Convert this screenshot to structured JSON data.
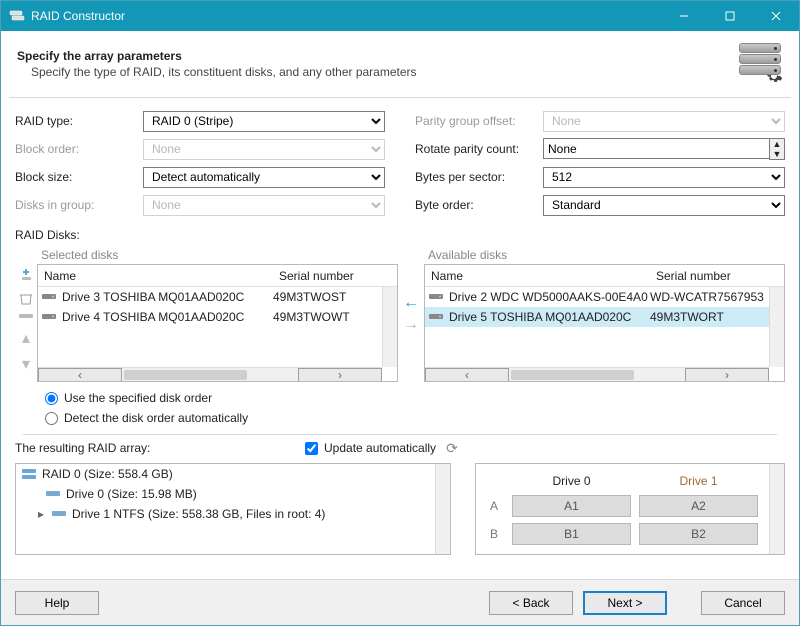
{
  "window": {
    "title": "RAID Constructor"
  },
  "header": {
    "title": "Specify the array parameters",
    "subtitle": "Specify the type of RAID, its constituent disks, and any other parameters"
  },
  "params_left": {
    "raid_type": {
      "label": "RAID type:",
      "value": "RAID 0 (Stripe)",
      "enabled": true
    },
    "block_order": {
      "label": "Block order:",
      "value": "None",
      "enabled": false
    },
    "block_size": {
      "label": "Block size:",
      "value": "Detect automatically",
      "enabled": true
    },
    "disks_group": {
      "label": "Disks in group:",
      "value": "None",
      "enabled": false
    }
  },
  "params_right": {
    "parity_offset": {
      "label": "Parity group offset:",
      "value": "None",
      "enabled": false
    },
    "rotate_parity": {
      "label": "Rotate parity count:",
      "value": "None",
      "enabled": true
    },
    "bytes_sector": {
      "label": "Bytes per sector:",
      "value": "512",
      "enabled": true
    },
    "byte_order": {
      "label": "Byte order:",
      "value": "Standard",
      "enabled": true
    }
  },
  "raid_disks_label": "RAID Disks:",
  "selected": {
    "title": "Selected disks",
    "cols": {
      "name": "Name",
      "sn": "Serial number"
    },
    "rows": [
      {
        "name": "Drive 3 TOSHIBA MQ01AAD020C",
        "sn": "49M3TWOST"
      },
      {
        "name": "Drive 4 TOSHIBA MQ01AAD020C",
        "sn": "49M3TWOWT"
      }
    ]
  },
  "available": {
    "title": "Available disks",
    "cols": {
      "name": "Name",
      "sn": "Serial number"
    },
    "rows": [
      {
        "name": "Drive 2 WDC WD5000AAKS-00E4A0",
        "sn": "WD-WCATR7567953",
        "selected": false
      },
      {
        "name": "Drive 5 TOSHIBA MQ01AAD020C",
        "sn": "49M3TWORT",
        "selected": true
      }
    ]
  },
  "order_radio": {
    "specified": "Use the specified disk order",
    "auto": "Detect the disk order automatically",
    "value": "specified"
  },
  "result": {
    "label": "The resulting RAID array:",
    "update_auto": "Update automatically",
    "update_checked": true,
    "tree": {
      "root": "RAID 0 (Size: 558.4 GB)",
      "child0": "Drive 0 (Size: 15.98 MB)",
      "child1": "Drive 1 NTFS (Size: 558.38 GB, Files in root: 4)"
    },
    "map": {
      "cols": [
        "Drive 0",
        "Drive 1"
      ],
      "rows": [
        {
          "label": "A",
          "cells": [
            "A1",
            "A2"
          ]
        },
        {
          "label": "B",
          "cells": [
            "B1",
            "B2"
          ]
        }
      ]
    }
  },
  "footer": {
    "help": "Help",
    "back": "< Back",
    "next": "Next >",
    "cancel": "Cancel"
  }
}
